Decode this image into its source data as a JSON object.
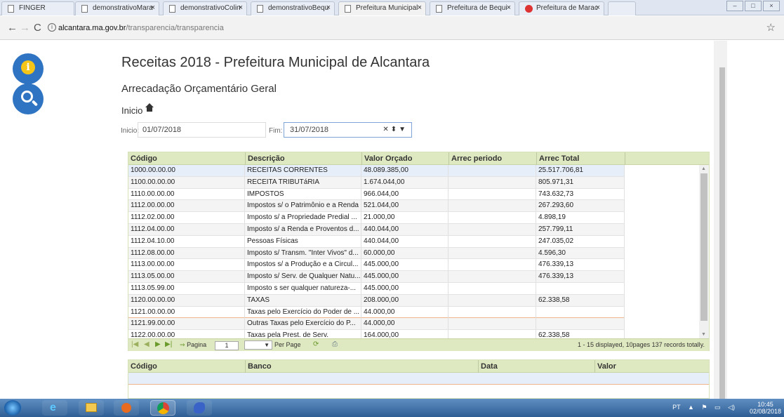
{
  "browser": {
    "tabs": [
      {
        "label": "FINGER",
        "active": false
      },
      {
        "label": "demonstrativoMara",
        "active": false
      },
      {
        "label": "demonstrativoColin",
        "active": false
      },
      {
        "label": "demonstrativoBequ",
        "active": false
      },
      {
        "label": "Prefeitura Municipal",
        "active": true
      },
      {
        "label": "Prefeitura de Bequi",
        "active": false
      },
      {
        "label": "Prefeitura de Marac",
        "active": false
      }
    ],
    "url_host": "alcantara.ma.gov.br",
    "url_path": "/transparencia/transparencia"
  },
  "page": {
    "title": "Receitas 2018 - Prefeitura Municipal de Alcantara",
    "subtitle": "Arrecadação Orçamentário Geral",
    "breadcrumb": "Inicio"
  },
  "filters": {
    "inicio_label": "Inicio:",
    "inicio_value": "01/07/2018",
    "fim_label": "Fim:",
    "fim_value": "31/07/2018"
  },
  "grid": {
    "columns": [
      "Código",
      "Descrição",
      "Valor Orçado",
      "Arrec periodo",
      "Arrec Total"
    ],
    "rows": [
      [
        "1000.00.00.00",
        "RECEITAS CORRENTES",
        "48.089.385,00",
        "",
        "25.517.706,81"
      ],
      [
        "1100.00.00.00",
        "RECEITA TRIBUTáRIA",
        "1.674.044,00",
        "",
        "805.971,31"
      ],
      [
        "1110.00.00.00",
        "IMPOSTOS",
        "966.044,00",
        "",
        "743.632,73"
      ],
      [
        "1112.00.00.00",
        "Impostos s/ o Patrimônio e a Renda",
        "521.044,00",
        "",
        "267.293,60"
      ],
      [
        "1112.02.00.00",
        "Imposto s/ a Propriedade Predial ...",
        "21.000,00",
        "",
        "4.898,19"
      ],
      [
        "1112.04.00.00",
        "Imposto s/ a Renda e Proventos d...",
        "440.044,00",
        "",
        "257.799,11"
      ],
      [
        "1112.04.10.00",
        "Pessoas Físicas",
        "440.044,00",
        "",
        "247.035,02"
      ],
      [
        "1112.08.00.00",
        "Imposto s/ Transm. \"Inter Vivos\" d...",
        "60.000,00",
        "",
        "4.596,30"
      ],
      [
        "1113.00.00.00",
        "Impostos s/ a Produção e a Circul...",
        "445.000,00",
        "",
        "476.339,13"
      ],
      [
        "1113.05.00.00",
        "Imposto s/ Serv. de Qualquer Natu...",
        "445.000,00",
        "",
        "476.339,13"
      ],
      [
        "1113.05.99.00",
        "Imposto s ser qualquer natureza-...",
        "445.000,00",
        "",
        ""
      ],
      [
        "1120.00.00.00",
        "TAXAS",
        "208.000,00",
        "",
        "62.338,58"
      ],
      [
        "1121.00.00.00",
        "Taxas pelo Exercício do Poder de ...",
        "44.000,00",
        "",
        ""
      ],
      [
        "1121.99.00.00",
        "Outras Taxas pelo Exercício do P...",
        "44.000,00",
        "",
        ""
      ],
      [
        "1122.00.00.00",
        "Taxas pela Prest. de Serv.",
        "164.000,00",
        "",
        "62.338,58"
      ]
    ],
    "pager": {
      "page_label": "Pagina",
      "page_value": "1",
      "per_page_label": "Per Page",
      "summary": "1 - 15 displayed, 10pages 137 records totally."
    }
  },
  "grid2": {
    "columns": [
      "Código",
      "Banco",
      "Data",
      "Valor"
    ]
  },
  "taskbar": {
    "lang": "PT",
    "time": "10:45",
    "date": "02/08/2018"
  }
}
